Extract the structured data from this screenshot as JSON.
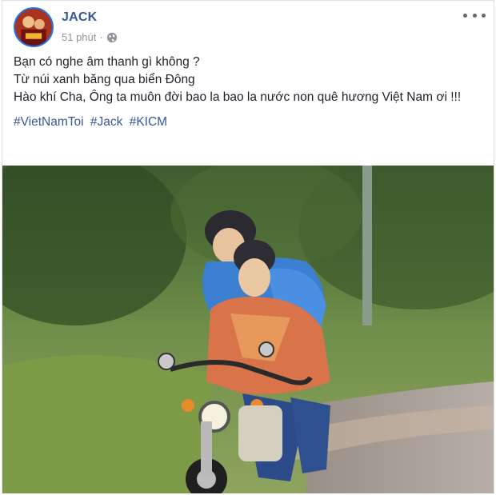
{
  "post": {
    "author": "JACK",
    "time": "51 phút",
    "separator": "·",
    "privacy_icon": "globe-icon",
    "more_icon": "more-options-icon",
    "lines": [
      "Bạn có nghe âm thanh gì không ?",
      "Từ núi xanh băng qua biển Đông",
      "Hào khí Cha, Ông ta muôn đời bao la bao la nước non quê hương Việt Nam ơi !!!"
    ],
    "hashtags": [
      "#VietNamToi",
      "#Jack",
      "#KICM"
    ],
    "photo": "two young men riding a motorbike on a country road"
  },
  "colors": {
    "author_link": "#365899",
    "meta_gray": "#90949c",
    "text": "#1d2129",
    "border": "#dddfe2"
  }
}
